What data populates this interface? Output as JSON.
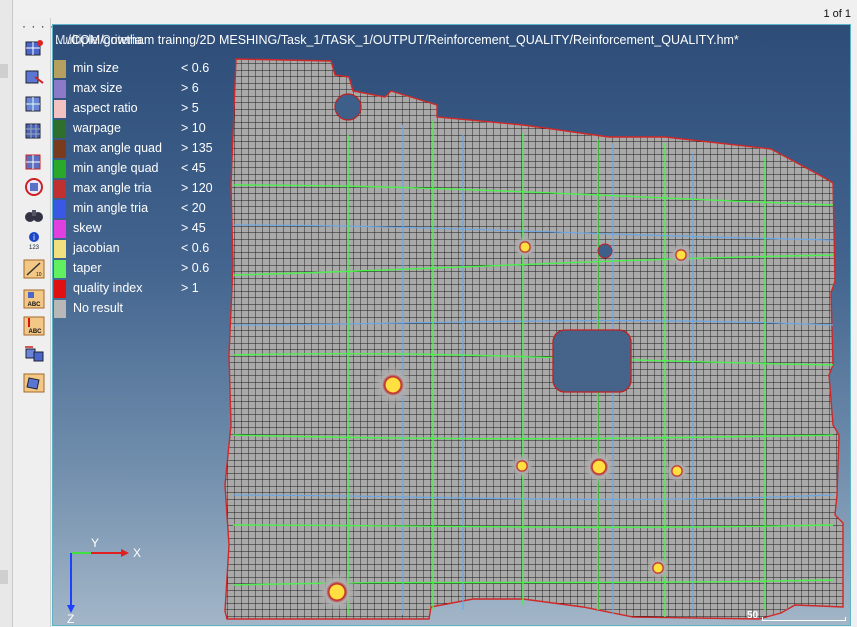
{
  "page_counter": "1 of 1",
  "toolbar_dots": "· · · ·",
  "viewport": {
    "title_overlay": "Multiple Criteria",
    "title_path": "…/COM/gowtham trainng/2D MESHING/Task_1/TASK_1/OUTPUT/Reinforcement_QUALITY/Reinforcement_QUALITY.hm*"
  },
  "legend": [
    {
      "label": "min size",
      "value": "< 0.6",
      "color": "#b5a060"
    },
    {
      "label": "max size",
      "value": "> 6",
      "color": "#8a7ac8"
    },
    {
      "label": "aspect ratio",
      "value": "> 5",
      "color": "#f2c2c2"
    },
    {
      "label": "warpage",
      "value": "> 10",
      "color": "#2e6e2e"
    },
    {
      "label": "max angle quad",
      "value": "> 135",
      "color": "#7a3a1e"
    },
    {
      "label": "min angle quad",
      "value": "< 45",
      "color": "#2aa82a"
    },
    {
      "label": "max angle tria",
      "value": "> 120",
      "color": "#c03030"
    },
    {
      "label": "min angle tria",
      "value": "< 20",
      "color": "#3a58e6"
    },
    {
      "label": "skew",
      "value": "> 45",
      "color": "#e040e0"
    },
    {
      "label": "jacobian",
      "value": "< 0.6",
      "color": "#f0e080"
    },
    {
      "label": "taper",
      "value": "> 0.6",
      "color": "#60f060"
    },
    {
      "label": "quality index",
      "value": "> 1",
      "color": "#e01010"
    },
    {
      "label": "No result",
      "value": "",
      "color": "#b8b8b8"
    }
  ],
  "axes": {
    "x": "X",
    "y": "Y",
    "z": "Z"
  },
  "scale": {
    "label": "50"
  },
  "toolbar_icons": [
    "element-check-icon",
    "normals-icon",
    "edges-icon",
    "mesh-quality-icon",
    "element-display-icon",
    "circle-select-icon",
    "binoculars-icon",
    "info-icon",
    "measure-icon",
    "label-abc-icon",
    "label-red-abc-icon",
    "mesh-transform-icon",
    "orientation-icon"
  ],
  "colors": {
    "mesh_fill": "#a9a9a9",
    "mesh_line": "#1a1a1a",
    "green_line": "#4cf04c",
    "blue_line": "#6aa7e6",
    "hole_yellow": "#ffe040"
  }
}
